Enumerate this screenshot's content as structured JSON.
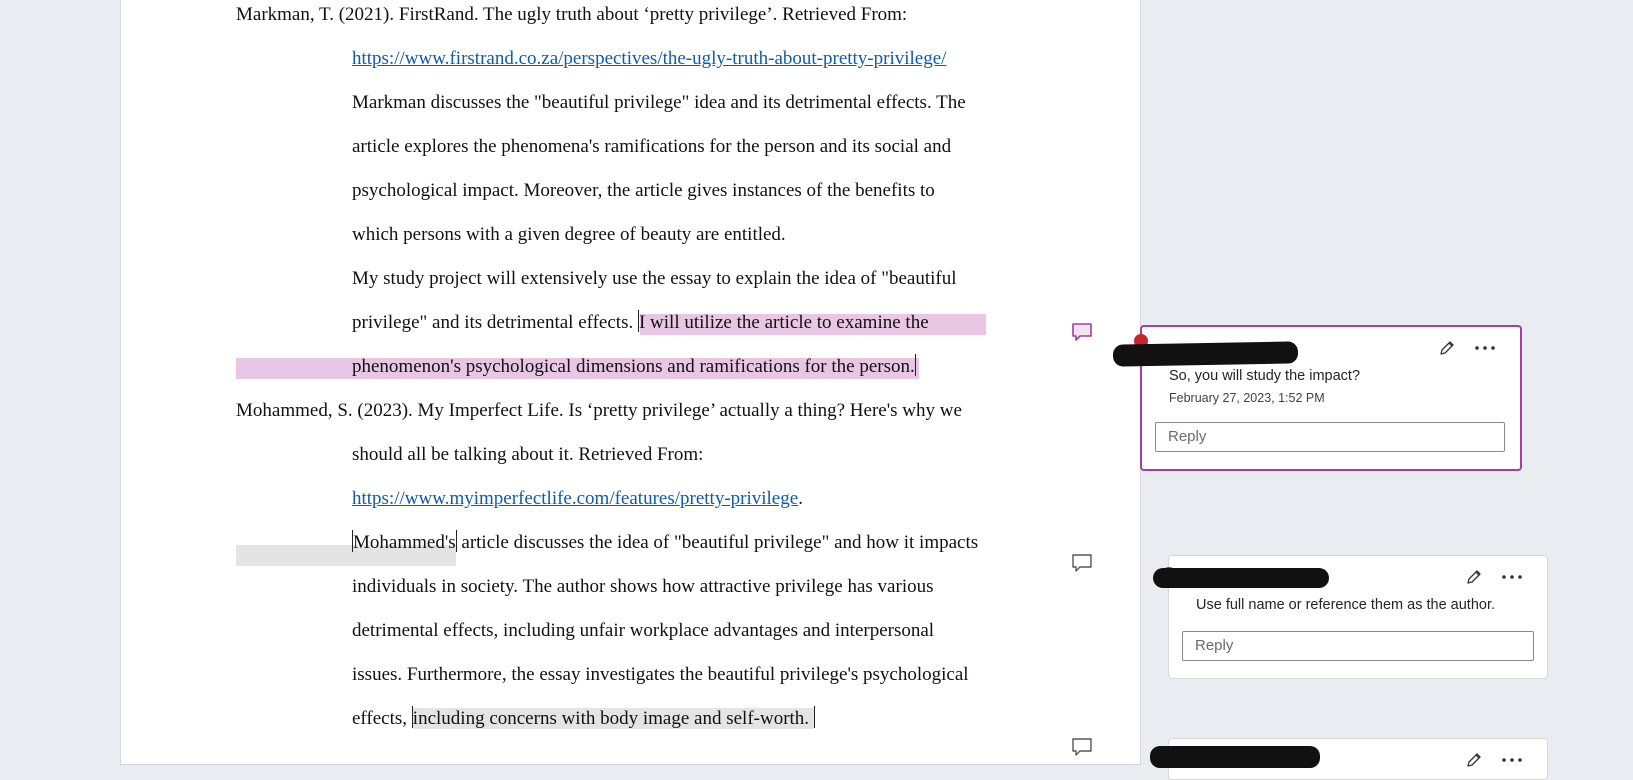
{
  "document": {
    "lines": [
      "Markman, T. (2021). FirstRand. The ugly truth about ‘pretty privilege’. Retrieved From:",
      "https://www.firstrand.co.za/perspectives/the-ugly-truth-about-pretty-privilege/",
      "Markman discusses the \"beautiful privilege\" idea and its detrimental effects. The",
      "article explores the phenomena's ramifications for the person and its social and",
      "psychological impact. Moreover, the article gives instances of the benefits to",
      "which persons with a given degree of beauty are entitled.",
      "My study project will extensively use the essay to explain the idea of \"beautiful",
      "privilege\" and its detrimental effects. ",
      "I will utilize the article to examine the",
      "phenomenon's psychological dimensions and ramifications for the person.",
      "Mohammed, S. (2023). My Imperfect Life. Is ‘pretty privilege’ actually a thing? Here's why we",
      "should all be talking about it. Retrieved From:",
      "https://www.myimperfectlife.com/features/pretty-privilege",
      ".",
      "Mohammed's",
      " article discusses the idea of \"beautiful privilege\" and how it impacts",
      "individuals in society. The author shows how attractive privilege has various",
      "detrimental effects, including unfair workplace advantages and interpersonal",
      "issues. Furthermore, the essay investigates the beautiful privilege's psychological",
      "effects, ",
      "including concerns with body image and self-worth. "
    ]
  },
  "comments": [
    {
      "text": "So, you will study the impact?",
      "date": "February 27, 2023, 1:52 PM",
      "reply_placeholder": "Reply"
    },
    {
      "text": "Use full name or reference them as the author.",
      "reply_placeholder": "Reply"
    }
  ],
  "colors": {
    "highlight_pink": "#e9c6e3",
    "highlight_gray": "#e4e4e4",
    "active_comment_border": "#a33fa0",
    "link": "#0b5cad"
  },
  "icons": [
    "comment-icon",
    "edit-icon",
    "more-options-icon"
  ]
}
